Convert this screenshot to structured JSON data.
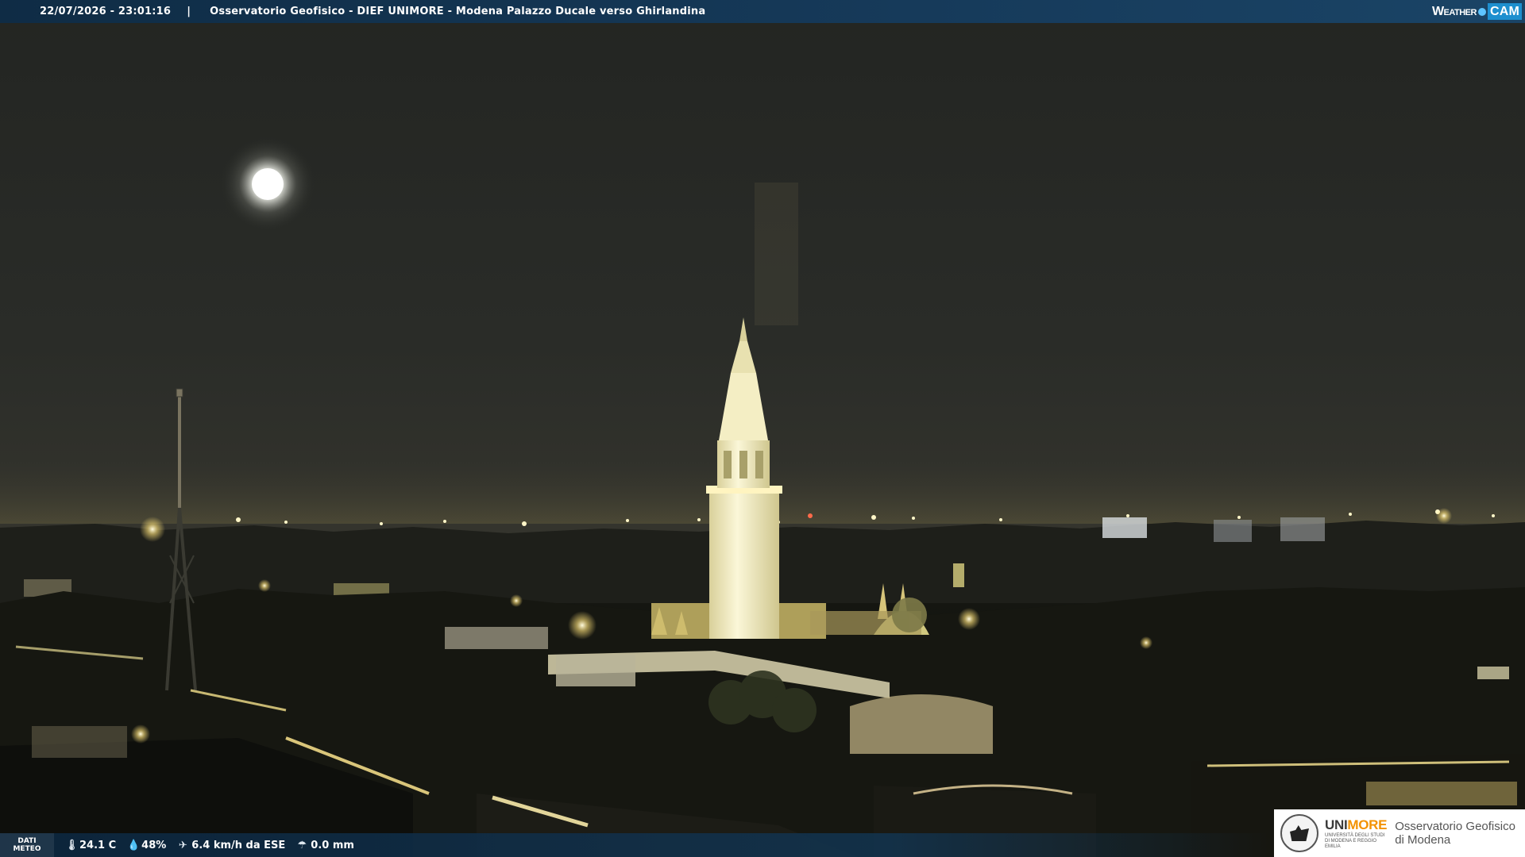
{
  "header": {
    "timestamp": "22/07/2026 - 23:01:16",
    "separator": "|",
    "caption": "Osservatorio Geofisico - DIEF UNIMORE - Modena Palazzo Ducale verso Ghirlandina",
    "logo_weather": "Weather",
    "logo_cam": "CAM"
  },
  "weather": {
    "label_line1": "DATI",
    "label_line2": "METEO",
    "temperature": "24.1 C",
    "humidity": "48%",
    "wind": "6.4 km/h da ESE",
    "rain": "0.0 mm",
    "icons": [
      "thermometer-icon",
      "humidity-drop-icon",
      "wind-icon",
      "rain-gauge-icon"
    ]
  },
  "institution": {
    "brand_part1": "UNI",
    "brand_part2": "MORE",
    "brand_subtitle": "UNIVERSITÀ DEGLI STUDI DI MODENA E REGGIO EMILIA",
    "name_line1": "Osservatorio Geofisico",
    "name_line2": "di Modena",
    "brand_color": "#f39200"
  },
  "colors": {
    "bar_bg": "#163a5a",
    "night_sky": "#2a2c28",
    "tower_light": "#f6f2c8"
  }
}
